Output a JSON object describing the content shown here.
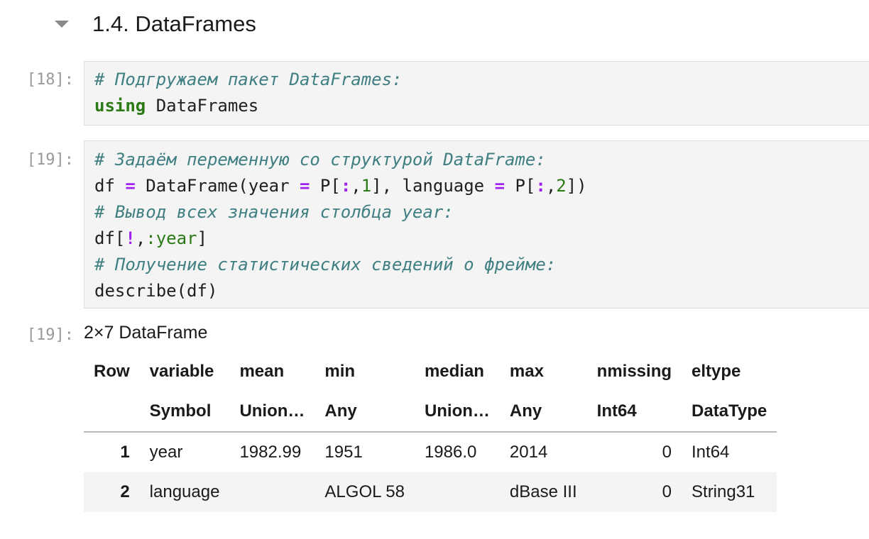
{
  "section": {
    "title": "1.4. DataFrames",
    "collapse_icon": "triangle-down-icon"
  },
  "cells": [
    {
      "prompt": "[18]:",
      "lines": [
        [
          {
            "t": "# Подгружаем пакет DataFrames:",
            "c": "cm"
          }
        ],
        [
          {
            "t": "using",
            "c": "kw"
          },
          {
            "t": " DataFrames",
            "c": ""
          }
        ]
      ]
    },
    {
      "prompt": "[19]:",
      "lines": [
        [
          {
            "t": "# Задаём переменную со структурой DataFrame:",
            "c": "cm"
          }
        ],
        [
          {
            "t": "df ",
            "c": ""
          },
          {
            "t": "=",
            "c": "op"
          },
          {
            "t": " DataFrame(year ",
            "c": ""
          },
          {
            "t": "=",
            "c": "op"
          },
          {
            "t": " P[",
            "c": ""
          },
          {
            "t": ":",
            "c": "op"
          },
          {
            "t": ",",
            "c": ""
          },
          {
            "t": "1",
            "c": "num"
          },
          {
            "t": "], language ",
            "c": ""
          },
          {
            "t": "=",
            "c": "op"
          },
          {
            "t": " P[",
            "c": ""
          },
          {
            "t": ":",
            "c": "op"
          },
          {
            "t": ",",
            "c": ""
          },
          {
            "t": "2",
            "c": "num"
          },
          {
            "t": "])",
            "c": ""
          }
        ],
        [
          {
            "t": "# Вывод всех значения столбца year:",
            "c": "cm"
          }
        ],
        [
          {
            "t": "df[",
            "c": ""
          },
          {
            "t": "!",
            "c": "op"
          },
          {
            "t": ",",
            "c": ""
          },
          {
            "t": ":year",
            "c": "sym"
          },
          {
            "t": "]",
            "c": ""
          }
        ],
        [
          {
            "t": "# Получение статистических сведений о фрейме:",
            "c": "cm"
          }
        ],
        [
          {
            "t": "describe(df)",
            "c": ""
          }
        ]
      ]
    }
  ],
  "output": {
    "prompt": "[19]:",
    "title": "2×7 DataFrame",
    "headers": [
      "Row",
      "variable",
      "mean",
      "min",
      "median",
      "max",
      "nmissing",
      "eltype"
    ],
    "types": [
      "",
      "Symbol",
      "Union…",
      "Any",
      "Union…",
      "Any",
      "Int64",
      "DataType"
    ],
    "rows": [
      [
        "1",
        "year",
        "1982.99",
        "1951",
        "1986.0",
        "2014",
        "0",
        "Int64"
      ],
      [
        "2",
        "language",
        "",
        "ALGOL 58",
        "",
        "dBase III",
        "0",
        "String31"
      ]
    ]
  }
}
